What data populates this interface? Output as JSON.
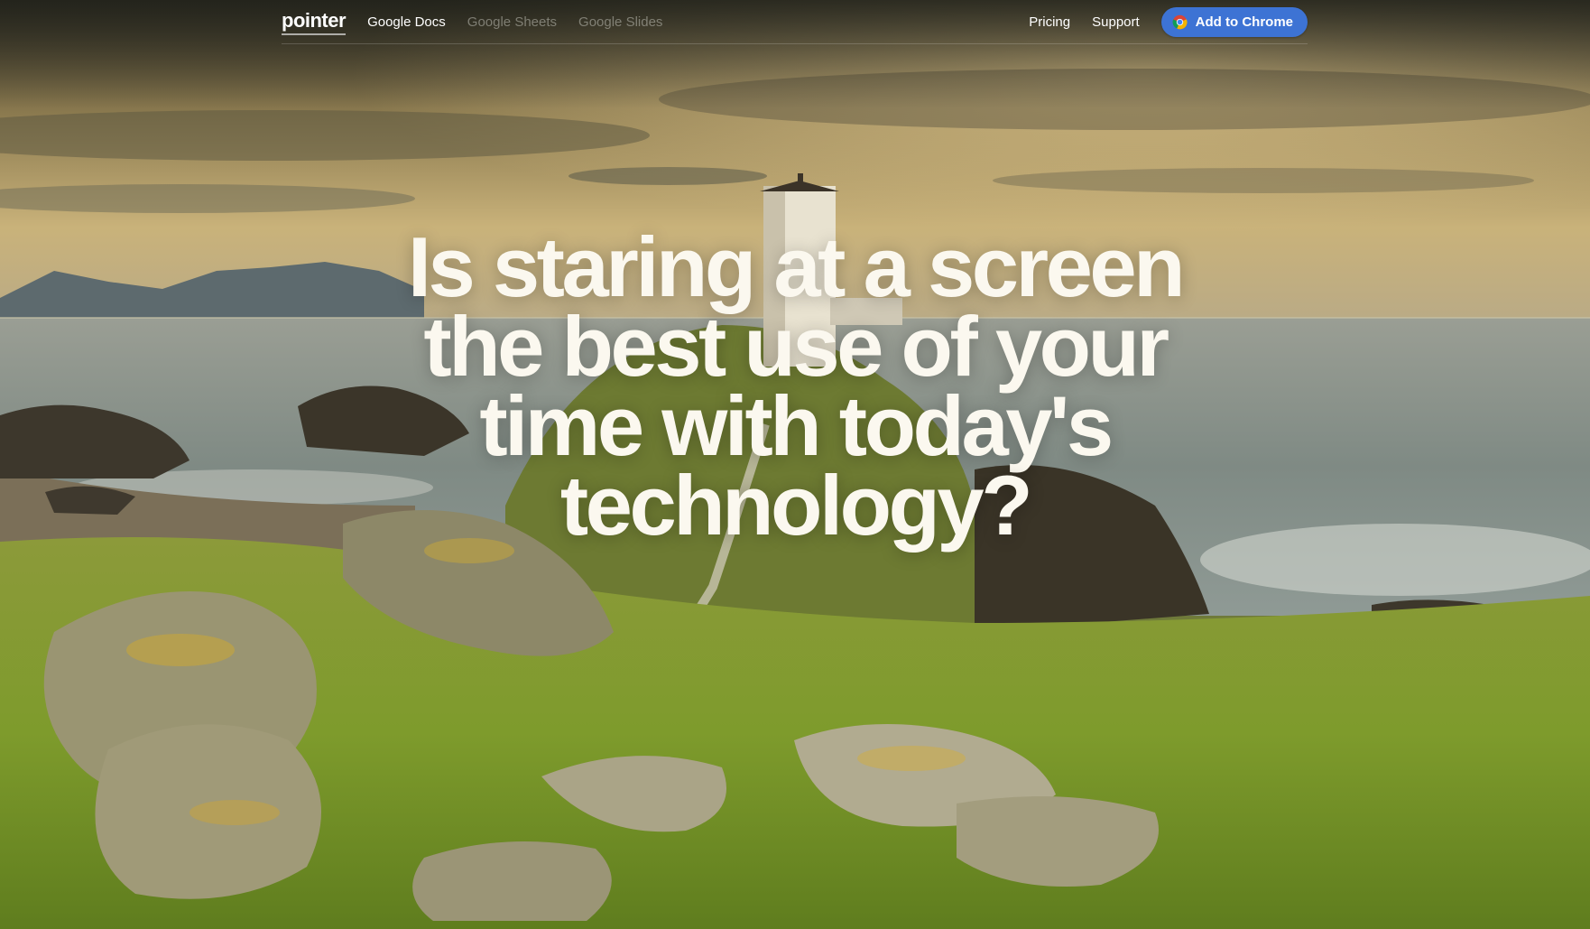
{
  "brand": {
    "logo_text": "pointer"
  },
  "nav": {
    "links": [
      {
        "label": "Google Docs",
        "active": true
      },
      {
        "label": "Google Sheets",
        "active": false
      },
      {
        "label": "Google Slides",
        "active": false
      }
    ],
    "right_links": [
      {
        "label": "Pricing"
      },
      {
        "label": "Support"
      }
    ],
    "cta": {
      "label": "Add to Chrome",
      "icon": "chrome-icon",
      "color": "#3d73d4"
    }
  },
  "hero": {
    "headline": "Is staring at a screen the best use of your time with today's technology?",
    "background": "lighthouse-coastal-landscape"
  },
  "colors": {
    "headline_text": "#fbf8ef",
    "nav_text": "#ffffff",
    "nav_text_muted": "#bebeb4"
  }
}
